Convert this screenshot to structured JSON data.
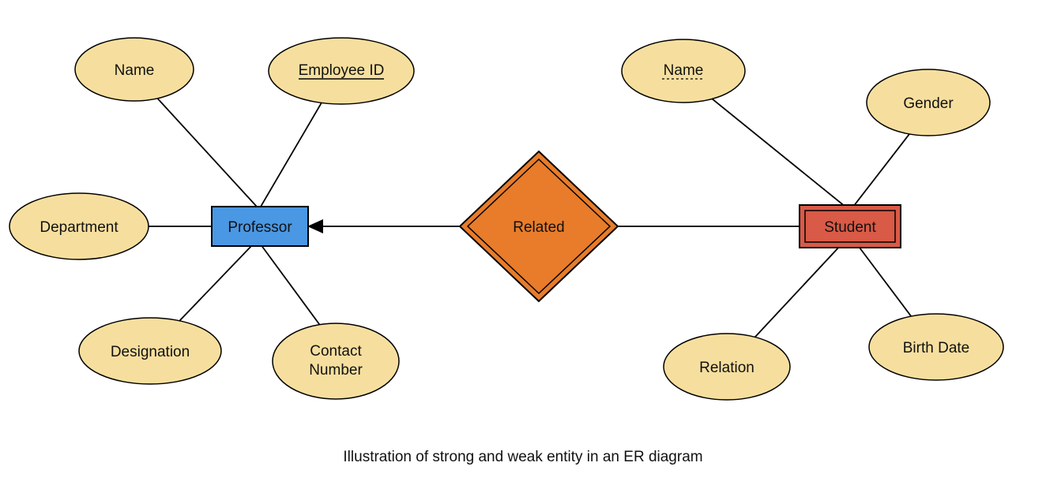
{
  "caption": "Illustration of strong and weak entity in an ER diagram",
  "entities": {
    "strong": {
      "label": "Professor"
    },
    "weak": {
      "label": "Student"
    }
  },
  "relationship": {
    "label": "Related"
  },
  "attributes": {
    "professor": {
      "name": {
        "label": "Name"
      },
      "employee_id": {
        "label": "Employee ID",
        "is_key": true
      },
      "department": {
        "label": "Department"
      },
      "designation": {
        "label": "Designation"
      },
      "contact_line1": {
        "label": "Contact"
      },
      "contact_line2": {
        "label": "Number"
      }
    },
    "student": {
      "name": {
        "label": "Name",
        "is_discriminator": true
      },
      "gender": {
        "label": "Gender"
      },
      "relation": {
        "label": "Relation"
      },
      "birthdate": {
        "label": "Birth Date"
      }
    }
  },
  "colors": {
    "attribute_fill": "#f6df9e",
    "strong_entity_fill": "#4a97e3",
    "weak_entity_fill": "#d95a46",
    "relationship_fill": "#e87c2a"
  }
}
